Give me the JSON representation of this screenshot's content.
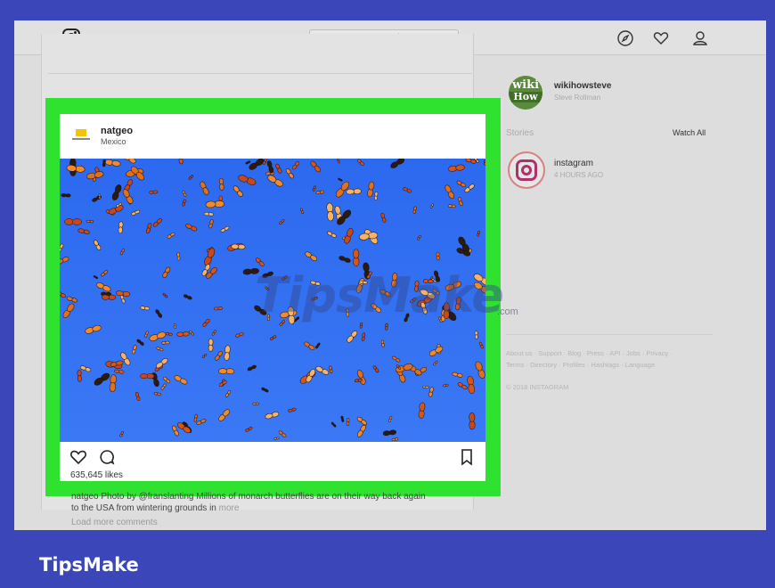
{
  "header": {
    "logo_icon": "instagram-logo-icon",
    "search_placeholder": "Q Search",
    "icons": [
      "compass-icon",
      "heart-icon",
      "profile-icon"
    ]
  },
  "post": {
    "username": "natgeo",
    "location": "Mexico",
    "likes": "635,645 likes",
    "caption_line1": "natgeo Photo by @franslanting Millions of monarch butterflies are on their way back again",
    "caption_line2": "to the USA from wintering grounds in",
    "more": "more",
    "load_more": "Load more comments"
  },
  "sidebar": {
    "avatar_text_1": "wiki",
    "avatar_text_2": "How",
    "username": "wikihowsteve",
    "full_name": "Steve Rollman",
    "stories_label": "Stories",
    "watch_all": "Watch All",
    "story_user": "instagram",
    "story_time": "4 HOURS AGO",
    "footer_line1": "About us · Support · Blog · Press · API · Jobs · Privacy ·",
    "footer_line2": "Terms · Directory · Profiles · Hashtags · Language",
    "footer_line3": "© 2018 INSTAGRAM"
  },
  "watermark": {
    "text": "TipsMake",
    "tld": ".com"
  },
  "brand": "TipsMake",
  "colors": {
    "background": "#3b46b8",
    "highlight": "#2fe22f",
    "photo_sky": "#2d6df0"
  }
}
